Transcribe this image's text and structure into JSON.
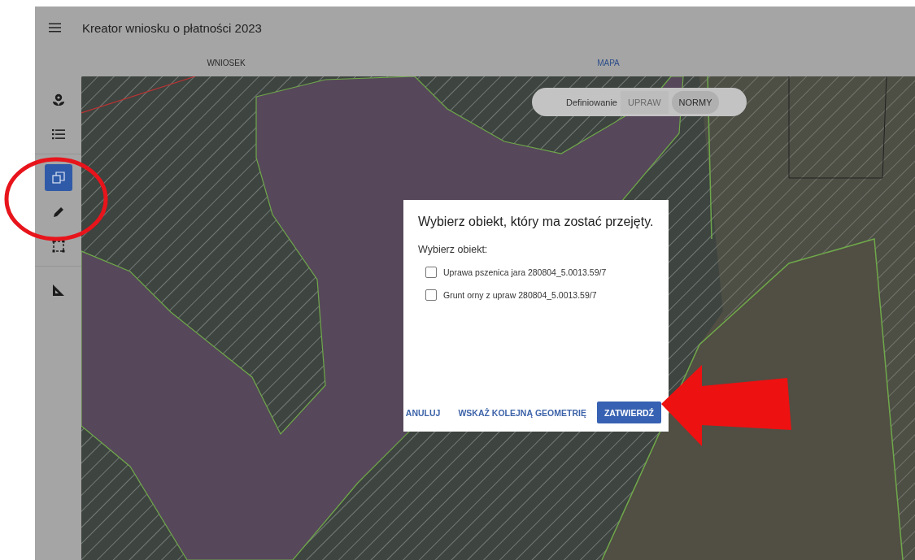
{
  "app_bar": {
    "title": "Kreator wniosku o płatności 2023"
  },
  "tabs": [
    {
      "label": "WNIOSEK",
      "selected": false
    },
    {
      "label": "MAPA",
      "selected": true
    }
  ],
  "tool_groups": [
    {
      "tools": [
        {
          "kind": "flower",
          "selected": false
        },
        {
          "kind": "list",
          "selected": false
        }
      ]
    },
    {
      "tools": [
        {
          "kind": "copy",
          "selected": true
        },
        {
          "kind": "pencil",
          "selected": false
        },
        {
          "kind": "select-box",
          "selected": false
        }
      ]
    },
    {
      "tools": [
        {
          "kind": "ruler",
          "selected": false
        }
      ]
    }
  ],
  "mode_toggle": {
    "label": "Definiowanie",
    "options": [
      {
        "label": "UPRAW",
        "selected": false
      },
      {
        "label": "NORMY",
        "selected": true
      }
    ]
  },
  "dialog": {
    "title": "Wybierz obiekt, który ma zostać przejęty.",
    "prompt": "Wybierz obiekt:",
    "options": [
      {
        "label": "Uprawa pszenica jara 280804_5.0013.59/7",
        "checked": false
      },
      {
        "label": "Grunt orny z upraw 280804_5.0013.59/7",
        "checked": false
      }
    ],
    "actions": [
      {
        "label": "ANULUJ",
        "kind": "text"
      },
      {
        "label": "WSKAŻ KOLEJNĄ GEOMETRIĘ",
        "kind": "text"
      },
      {
        "label": "ZATWIERDŹ",
        "kind": "primary"
      }
    ]
  },
  "annotations": {
    "highlight_circle": true,
    "pointer_arrow": true
  }
}
